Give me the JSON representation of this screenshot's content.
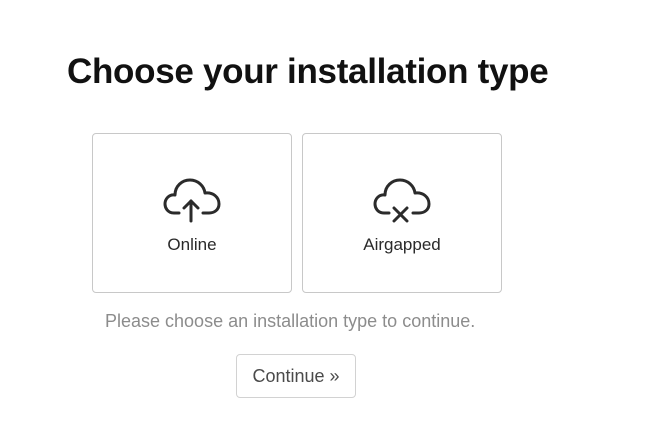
{
  "page": {
    "title": "Choose your installation type"
  },
  "options": [
    {
      "label": "Online",
      "icon": "cloud-upload-icon"
    },
    {
      "label": "Airgapped",
      "icon": "cloud-off-icon"
    }
  ],
  "hint": "Please choose an installation type to continue.",
  "continue_label": "Continue »"
}
